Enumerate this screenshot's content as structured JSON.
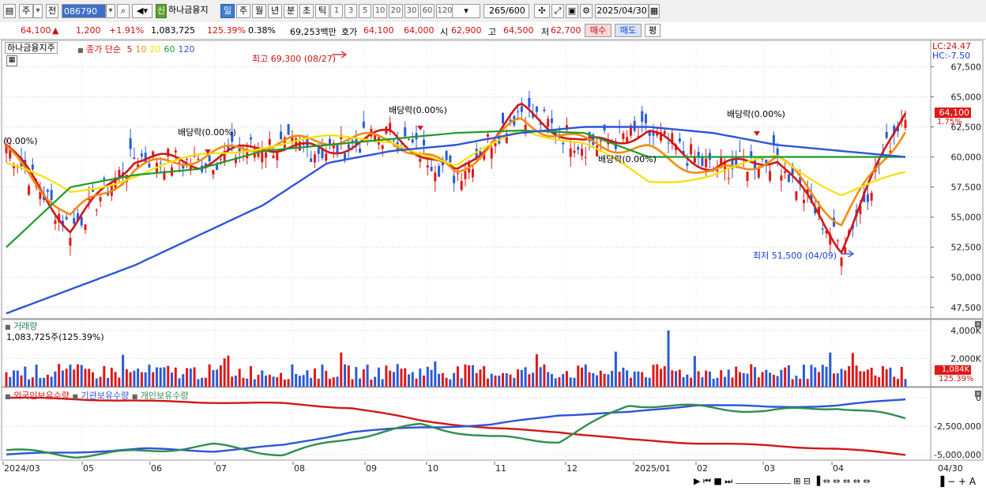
{
  "toolbar": {
    "market_label": "주",
    "type_label": "전",
    "code": "086790",
    "stock_name": "하나금융지",
    "credit_badge": "신",
    "periods": [
      "일",
      "주",
      "월",
      "년",
      "분",
      "초",
      "틱"
    ],
    "active_period": "일",
    "intervals": [
      "1",
      "3",
      "5",
      "10",
      "20",
      "30",
      "60",
      "120"
    ],
    "count": "265",
    "count_total": "/600",
    "date": "2025/04/30"
  },
  "quote": {
    "price": "64,100",
    "change": "1,200",
    "change_pct": "+1.91%",
    "volume": "1,083,725",
    "volume_ratio": "125.39%",
    "turnover": "0.38%",
    "amount": "69,253백만",
    "bid_label": "호가",
    "ask": "64,100",
    "bid": "64,000",
    "open_label": "시",
    "open": "62,900",
    "high_label": "고",
    "high": "64,500",
    "low_label": "저",
    "low": "62,700",
    "buy_label": "매수",
    "sell_label": "매도",
    "eval_label": "평"
  },
  "price_panel": {
    "title": "하나금융지주",
    "ma_label": "종가 단순",
    "ma_periods": [
      "5",
      "10",
      "20",
      "60",
      "120"
    ],
    "ma_colors": [
      "#d01818",
      "#f28c0f",
      "#f3e200",
      "#1f9a2c",
      "#2f55d8"
    ],
    "lc": "LC:24.47",
    "hc": "HC:-7.50",
    "last_price": "64,100",
    "last_pct": "1.75%",
    "y_ticks": [
      "67,500",
      "65,000",
      "62,500",
      "60,000",
      "57,500",
      "55,000",
      "52,500",
      "50,000",
      "47,500"
    ],
    "high_note": "최고 69,300 (08/27)",
    "low_note": "최저 51,500 (04/09)",
    "div_left": "(0.00%)",
    "div_notes": [
      "배당락(0.00%)",
      "배당락(0.00%)",
      "배당락(0.00%)",
      "배당락(0.00%)"
    ]
  },
  "volume_panel": {
    "title": "거래량",
    "value": "1,083,725주(125.39%)",
    "y_ticks": [
      "4,000K",
      "2,000K"
    ],
    "last": "1,084K",
    "last_pct": "125.39%"
  },
  "holding_panel": {
    "series": [
      "외국인보유수량",
      "기관보유수량",
      "개인보유수량"
    ],
    "colors": [
      "#d01818",
      "#2f55d8",
      "#2f8f4f"
    ],
    "y_ticks": [
      "0",
      "-2,500,000",
      "-5,000,000"
    ]
  },
  "x_axis": {
    "labels": [
      "2024/03",
      "05",
      "06",
      "07",
      "08",
      "09",
      "10",
      "11",
      "12",
      "2025/01",
      "02",
      "03",
      "04",
      "04/30"
    ]
  },
  "chart_data": {
    "type": "line",
    "title": "하나금융지주",
    "x": [
      "2024/03",
      "05",
      "06",
      "07",
      "08",
      "09",
      "10",
      "11",
      "12",
      "2025/01",
      "02",
      "03",
      "04",
      "04/30"
    ],
    "ylim": [
      46500,
      69300
    ],
    "series": [
      {
        "name": "5",
        "values": [
          61000,
          54000,
          60000,
          59500,
          61000,
          60500,
          62000,
          58500,
          64000,
          61000,
          62000,
          59000,
          60000,
          52500,
          64100
        ]
      },
      {
        "name": "10",
        "values": [
          60500,
          55000,
          59000,
          60000,
          61000,
          61500,
          61500,
          58700,
          63000,
          61200,
          60500,
          58500,
          60000,
          54500,
          62500
        ]
      },
      {
        "name": "20",
        "values": [
          59500,
          57000,
          58500,
          60000,
          61000,
          61500,
          61500,
          59000,
          62500,
          61000,
          58000,
          58500,
          60000,
          57000,
          58500
        ]
      },
      {
        "name": "60",
        "values": [
          52500,
          57500,
          58500,
          59000,
          60500,
          61000,
          61500,
          62000,
          62200,
          62000,
          60000,
          60000,
          60000,
          60000,
          60000
        ]
      },
      {
        "name": "120",
        "values": [
          47000,
          49000,
          51000,
          53500,
          56000,
          59500,
          60500,
          61000,
          62000,
          62500,
          62500,
          62000,
          61000,
          60500,
          60000
        ]
      }
    ],
    "volume_ylim": [
      0,
      4500
    ],
    "holding_ylim": [
      -5500000,
      500000
    ]
  }
}
